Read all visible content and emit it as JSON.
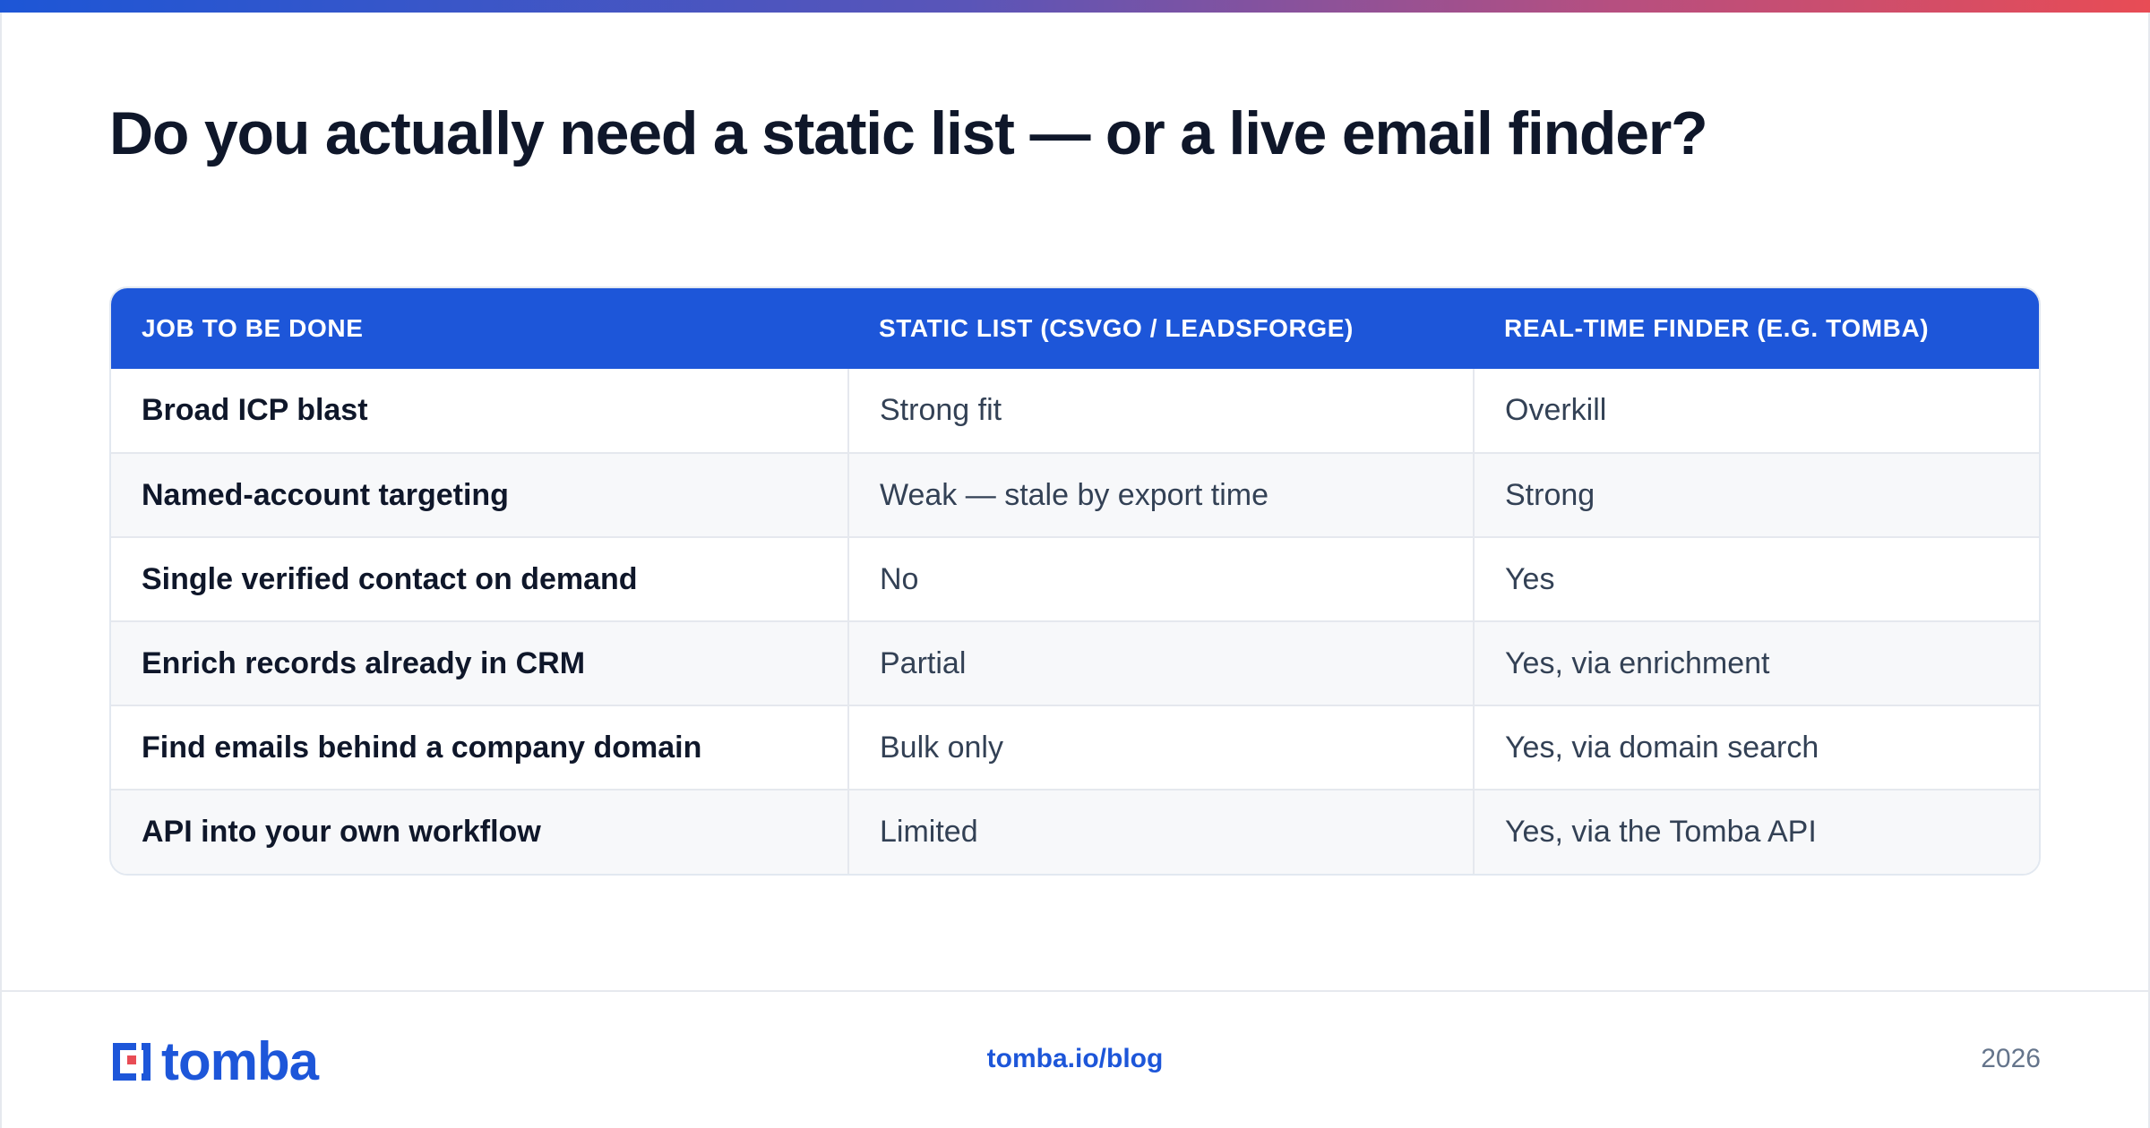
{
  "headline": "Do you actually need a static list — or a live email finder?",
  "table": {
    "headers": [
      "JOB TO BE DONE",
      "STATIC LIST (CSVGO / LEADSFORGE)",
      "REAL-TIME FINDER (E.G. TOMBA)"
    ],
    "rows": [
      {
        "job": "Broad ICP blast",
        "static": "Strong fit",
        "realtime": "Overkill"
      },
      {
        "job": "Named-account targeting",
        "static": "Weak — stale by export time",
        "realtime": "Strong"
      },
      {
        "job": "Single verified contact on demand",
        "static": "No",
        "realtime": "Yes"
      },
      {
        "job": "Enrich records already in CRM",
        "static": "Partial",
        "realtime": "Yes, via enrichment"
      },
      {
        "job": "Find emails behind a company domain",
        "static": "Bulk only",
        "realtime": "Yes, via domain search"
      },
      {
        "job": "API into your own workflow",
        "static": "Limited",
        "realtime": "Yes, via the Tomba API"
      }
    ]
  },
  "footer": {
    "logo_text": "tomba",
    "link": "tomba.io/blog",
    "year": "2026"
  },
  "colors": {
    "brand_blue": "#1d56d9",
    "brand_red": "#e84c55",
    "heading": "#0f172a",
    "body": "#334155"
  }
}
